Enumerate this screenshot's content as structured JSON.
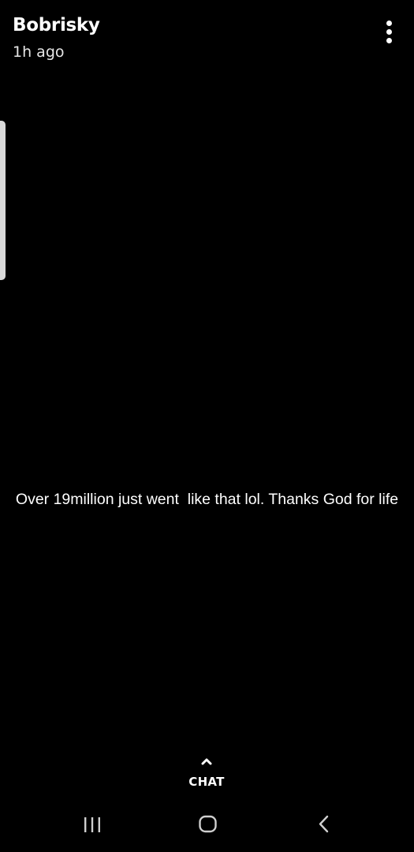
{
  "story": {
    "username": "Bobrisky",
    "timestamp": "1h ago",
    "caption": "Over 19million just went  like that lol. Thanks God for life"
  },
  "chat": {
    "label": "CHAT",
    "icon": "chevron-up-icon"
  },
  "header": {
    "menu_icon": "more-vertical-icon"
  },
  "navigation": {
    "recents_icon": "recents-icon",
    "home_icon": "home-icon",
    "back_icon": "back-icon"
  },
  "colors": {
    "background": "#000000",
    "text": "#ffffff"
  }
}
